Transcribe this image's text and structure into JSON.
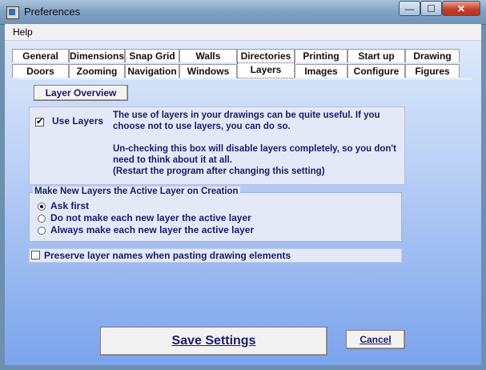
{
  "window": {
    "title": "Preferences"
  },
  "menu": {
    "help": "Help"
  },
  "tabs_row1": [
    "General",
    "Dimensions",
    "Snap Grid",
    "Walls",
    "Directories",
    "Printing",
    "Start up",
    "Drawing"
  ],
  "tabs_row2": [
    "Doors",
    "Zooming",
    "Navigation",
    "Windows",
    "Layers",
    "Images",
    "Configure",
    "Figures"
  ],
  "active_tab": "Layers",
  "layers": {
    "overview_button": "Layer Overview",
    "use_layers": {
      "label": "Use Layers",
      "checked": true
    },
    "description": [
      "The use of layers in your drawings can be quite useful. If you",
      "choose not to use layers, you can do so.",
      "",
      "Un-checking this box will disable layers completely, so you don't",
      "need to think about it at all.",
      "(Restart the program after changing this setting)"
    ],
    "active_group": {
      "title": "Make New Layers the Active Layer on Creation",
      "options": [
        "Ask first",
        "Do not make each new layer the active layer",
        "Always make each new layer the active layer"
      ],
      "selected": "Ask first"
    },
    "preserve_names": {
      "label": "Preserve layer names when pasting drawing elements",
      "checked": false
    }
  },
  "buttons": {
    "save": "Save Settings",
    "cancel": "Cancel"
  },
  "window_buttons": {
    "minimize": "—",
    "maximize": "☐",
    "close": "✕"
  }
}
